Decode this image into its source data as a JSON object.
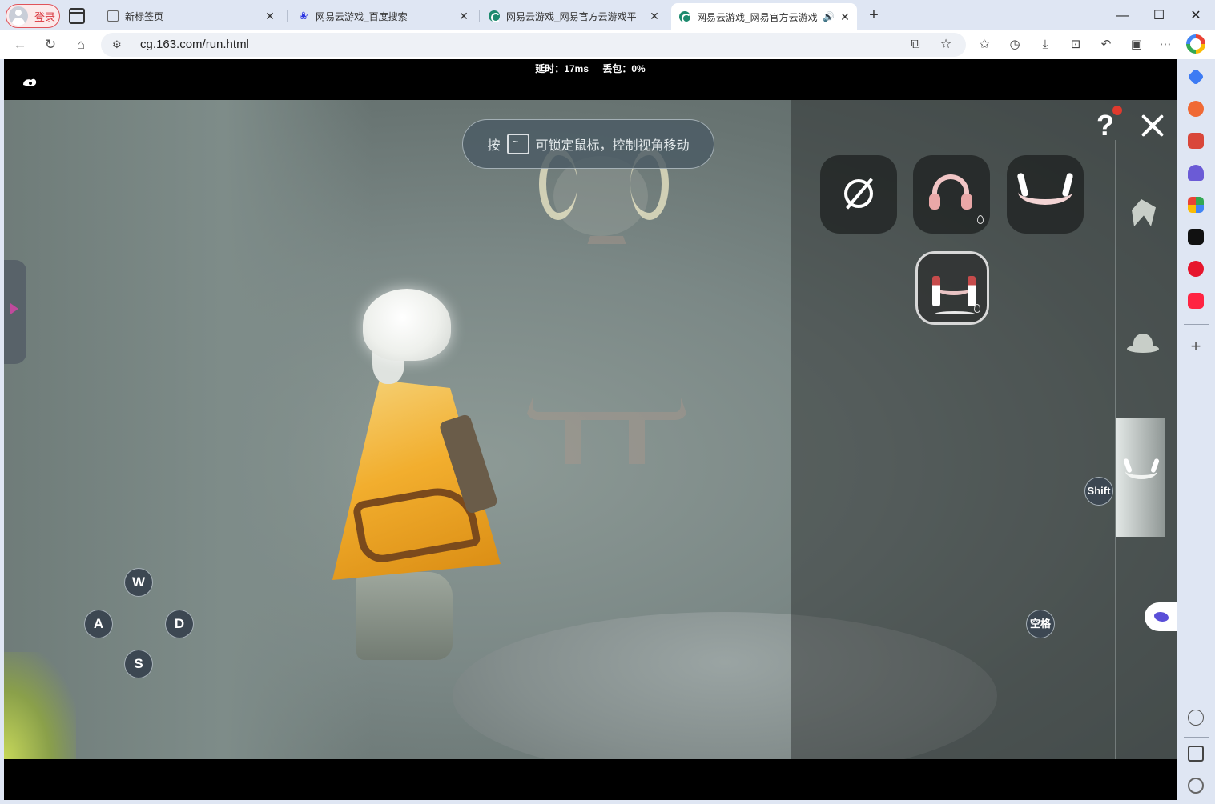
{
  "browser": {
    "login_label": "登录",
    "tabs": [
      {
        "title": "新标签页",
        "active": false
      },
      {
        "title": "网易云游戏_百度搜索",
        "active": false
      },
      {
        "title": "网易云游戏_网易官方云游戏平",
        "active": false
      },
      {
        "title": "网易云游戏_网易官方云游戏",
        "active": true
      }
    ],
    "url": "cg.163.com/run.html"
  },
  "stream_stats": {
    "latency": "延时：17ms",
    "packet_loss": "丢包：0%"
  },
  "game": {
    "hint_prefix": "按",
    "hint_text": "可锁定鼠标，控制视角移动",
    "help_label": "?",
    "keys": {
      "w": "W",
      "a": "A",
      "s": "S",
      "d": "D",
      "shift": "Shift",
      "space": "空格"
    },
    "items": [
      {
        "name": "none-icon"
      },
      {
        "name": "headphones-icon"
      },
      {
        "name": "horns-icon"
      },
      {
        "name": "tassel-headdress-icon",
        "selected": true
      }
    ],
    "categories": [
      "hair-icon",
      "hat-icon",
      "horn-accessory-icon"
    ]
  },
  "colors": {
    "accent_red": "#e03a2e",
    "keycap": "#3c4752",
    "cape": "#f2ae2e"
  }
}
